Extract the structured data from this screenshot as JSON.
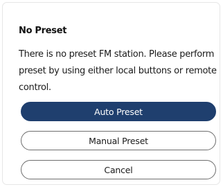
{
  "dialog": {
    "title": "No Preset",
    "message": "There is no preset FM station. Please perform preset by using either local buttons or remote control.",
    "buttons": {
      "auto_preset": "Auto Preset",
      "manual_preset": "Manual Preset",
      "cancel": "Cancel"
    }
  },
  "colors": {
    "primary_button": "#1f3f6e",
    "secondary_border": "#6e6e6e"
  }
}
